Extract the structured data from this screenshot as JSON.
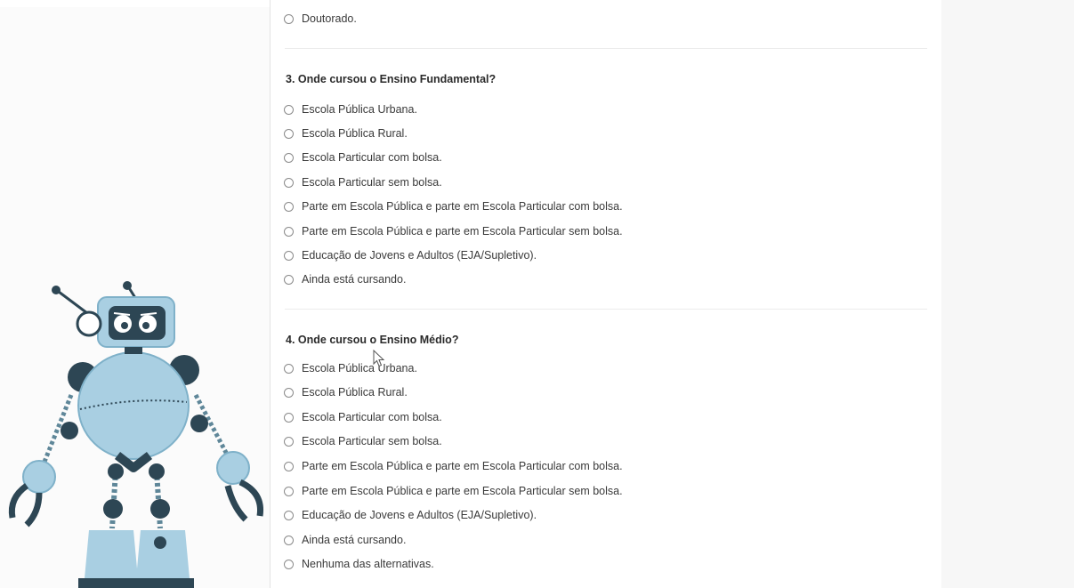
{
  "previous": {
    "last_option": "Doutorado."
  },
  "q3": {
    "title": "3. Onde cursou o Ensino Fundamental?",
    "options": [
      "Escola Pública Urbana.",
      "Escola Pública Rural.",
      "Escola Particular com bolsa.",
      "Escola Particular sem bolsa.",
      "Parte em Escola Pública e parte em Escola Particular com bolsa.",
      "Parte em Escola Pública e parte em Escola Particular sem bolsa.",
      "Educação de Jovens e Adultos (EJA/Supletivo).",
      "Ainda está cursando."
    ]
  },
  "q4": {
    "title": "4. Onde cursou o Ensino Médio?",
    "options": [
      "Escola Pública Urbana.",
      "Escola Pública Rural.",
      "Escola Particular com bolsa.",
      "Escola Particular sem bolsa.",
      "Parte em Escola Pública e parte em Escola Particular com bolsa.",
      "Parte em Escola Pública e parte em Escola Particular sem bolsa.",
      "Educação de Jovens e Adultos (EJA/Supletivo).",
      "Ainda está cursando.",
      "Nenhuma das alternativas."
    ]
  },
  "colors": {
    "robot_light": "#a9cfe2",
    "robot_dark": "#2d4654",
    "robot_mid": "#7fb1c9"
  }
}
